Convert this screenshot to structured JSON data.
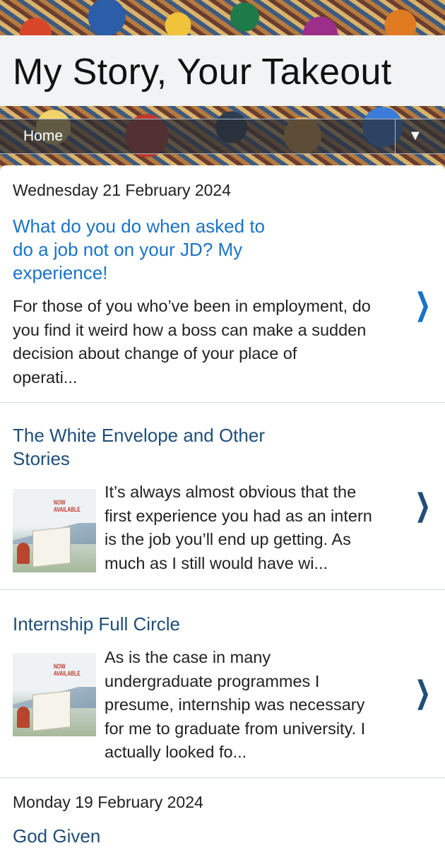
{
  "site": {
    "title": "My Story, Your Takeout"
  },
  "nav": {
    "home_label": "Home",
    "menu_arrow": "▼"
  },
  "chevron": "❯",
  "thumb_tag": "NOW\nAVAILABLE",
  "colors": {
    "link_blue": "#1a73c8",
    "title_dark_blue": "#1f4e79",
    "chevron_blue": "#1565c0"
  },
  "posts": [
    {
      "date": "Wednesday 21 February 2024",
      "title_lines": [
        "What do you do when asked to",
        "do a job not on your JD? My",
        "experience!"
      ],
      "snippet_lines": [
        "For those of you who’ve been in employment, do",
        "you find it weird how a boss can make a sudden",
        "decision about change of your place of",
        "operati..."
      ]
    },
    {
      "title_lines": [
        "The White Envelope and Other",
        "Stories"
      ],
      "snippet_lines": [
        "It’s always almost obvious that the",
        "first experience you had as an intern",
        "is the job you’ll end up getting. As",
        "much as I still would have wi..."
      ]
    },
    {
      "title_lines": [
        "Internship Full Circle"
      ],
      "snippet_lines": [
        "As is the case in many",
        "undergraduate programmes I",
        "presume, internship was necessary",
        "for me to graduate from university. I",
        "actually looked fo..."
      ]
    },
    {
      "date": "Monday 19 February 2024",
      "title_lines": [
        "God Given"
      ]
    }
  ]
}
